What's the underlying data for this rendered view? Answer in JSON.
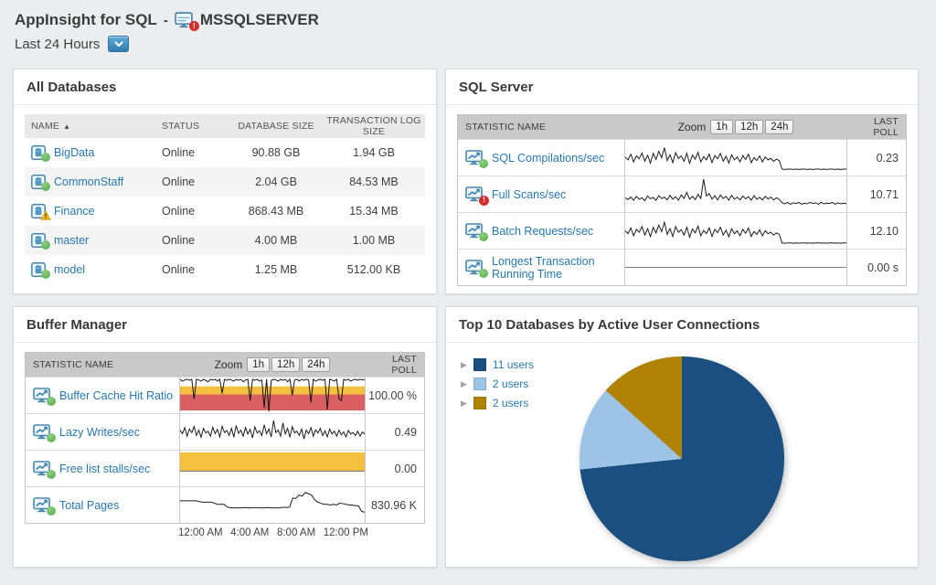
{
  "header": {
    "title": "AppInsight for SQL",
    "dash": "-",
    "server": "MSSQLSERVER",
    "time_range": "Last 24 Hours"
  },
  "panels": {
    "all_databases": {
      "title": "All Databases",
      "col_name": "NAME",
      "col_status": "STATUS",
      "col_db_size": "DATABASE SIZE",
      "col_log_size": "TRANSACTION LOG SIZE",
      "rows": [
        {
          "name": "BigData",
          "status": "Online",
          "db_size": "90.88 GB",
          "log_size": "1.94 GB"
        },
        {
          "name": "CommonStaff",
          "status": "Online",
          "db_size": "2.04 GB",
          "log_size": "84.53 MB"
        },
        {
          "name": "Finance",
          "status": "Online",
          "db_size": "868.43 MB",
          "log_size": "15.34 MB"
        },
        {
          "name": "master",
          "status": "Online",
          "db_size": "4.00 MB",
          "log_size": "1.00 MB"
        },
        {
          "name": "model",
          "status": "Online",
          "db_size": "1.25 MB",
          "log_size": "512.00 KB"
        }
      ]
    },
    "sql_server": {
      "title": "SQL Server",
      "col_stat": "STATISTIC NAME",
      "zoom_label": "Zoom",
      "zoom_options": [
        "1h",
        "12h",
        "24h"
      ],
      "col_last_poll": "LAST POLL",
      "rows": [
        {
          "name": "SQL Compilations/sec",
          "last_poll": "0.23"
        },
        {
          "name": "Full Scans/sec",
          "last_poll": "10.71"
        },
        {
          "name": "Batch Requests/sec",
          "last_poll": "12.10"
        },
        {
          "name": "Longest Transaction Running Time",
          "last_poll": "0.00 s"
        }
      ]
    },
    "buffer_manager": {
      "title": "Buffer Manager",
      "col_stat": "STATISTIC NAME",
      "zoom_label": "Zoom",
      "zoom_options": [
        "1h",
        "12h",
        "24h"
      ],
      "col_last_poll": "LAST POLL",
      "rows": [
        {
          "name": "Buffer Cache Hit Ratio",
          "last_poll": "100.00 %"
        },
        {
          "name": "Lazy Writes/sec",
          "last_poll": "0.49"
        },
        {
          "name": "Free list stalls/sec",
          "last_poll": "0.00"
        },
        {
          "name": "Total Pages",
          "last_poll": "830.96 K"
        }
      ],
      "x_axis": [
        "12:00 AM",
        "4:00 AM",
        "8:00 AM",
        "12:00 PM"
      ]
    },
    "top10": {
      "title": "Top 10 Databases by Active User Connections",
      "legend": [
        {
          "label": "11 users"
        },
        {
          "label": "2 users"
        },
        {
          "label": "2 users"
        }
      ]
    }
  },
  "colors": {
    "link_blue": "#2878b0",
    "critical_red": "#d22f2f",
    "up_green": "#55a94a",
    "warning_yellow": "#f5b819",
    "threshold_yellow": "#f3c13d",
    "threshold_red": "#d95f62",
    "value_red": "#d9454f"
  },
  "chart_data": [
    {
      "id": "sql_compilations_per_sec",
      "type": "line",
      "title": "SQL Compilations/sec",
      "x_range": "last 24 hours",
      "line_color": "#1c1c1c",
      "values": [
        0.52,
        0.44,
        0.6,
        0.38,
        0.55,
        0.47,
        0.63,
        0.4,
        0.57,
        0.35,
        0.62,
        0.45,
        0.68,
        0.5,
        0.78,
        0.42,
        0.58,
        0.36,
        0.64,
        0.48,
        0.55,
        0.4,
        0.62,
        0.34,
        0.57,
        0.46,
        0.65,
        0.38,
        0.53,
        0.44,
        0.6,
        0.36,
        0.56,
        0.47,
        0.62,
        0.4,
        0.54,
        0.35,
        0.58,
        0.44,
        0.52,
        0.38,
        0.56,
        0.45,
        0.6,
        0.36,
        0.5,
        0.42,
        0.55,
        0.38,
        0.52,
        0.44,
        0.48,
        0.4,
        0.46,
        0.42,
        0.18,
        0.17,
        0.18,
        0.18,
        0.17,
        0.18,
        0.17,
        0.18,
        0.18,
        0.17,
        0.18,
        0.17,
        0.18,
        0.18,
        0.17,
        0.18,
        0.17,
        0.18,
        0.18,
        0.17,
        0.18,
        0.17,
        0.18,
        0.18
      ]
    },
    {
      "id": "full_scans_per_sec",
      "type": "line",
      "title": "Full Scans/sec",
      "x_range": "last 24 hours",
      "line_color": "#1c1c1c",
      "values": [
        0.4,
        0.35,
        0.42,
        0.33,
        0.44,
        0.36,
        0.4,
        0.32,
        0.45,
        0.37,
        0.41,
        0.33,
        0.46,
        0.38,
        0.42,
        0.34,
        0.47,
        0.36,
        0.43,
        0.33,
        0.48,
        0.38,
        0.55,
        0.36,
        0.44,
        0.35,
        0.5,
        0.38,
        0.92,
        0.45,
        0.52,
        0.36,
        0.46,
        0.34,
        0.48,
        0.38,
        0.44,
        0.33,
        0.47,
        0.36,
        0.42,
        0.34,
        0.45,
        0.37,
        0.43,
        0.33,
        0.46,
        0.36,
        0.41,
        0.34,
        0.44,
        0.37,
        0.42,
        0.34,
        0.4,
        0.36,
        0.26,
        0.23,
        0.27,
        0.22,
        0.26,
        0.24,
        0.27,
        0.22,
        0.25,
        0.23,
        0.27,
        0.24,
        0.26,
        0.22,
        0.27,
        0.23,
        0.25,
        0.24,
        0.27,
        0.22,
        0.26,
        0.23,
        0.25,
        0.24
      ]
    },
    {
      "id": "batch_requests_per_sec",
      "type": "line",
      "title": "Batch Requests/sec",
      "x_range": "last 24 hours",
      "line_color": "#1c1c1c",
      "values": [
        0.5,
        0.42,
        0.58,
        0.36,
        0.54,
        0.46,
        0.62,
        0.38,
        0.56,
        0.34,
        0.6,
        0.44,
        0.66,
        0.48,
        0.74,
        0.4,
        0.56,
        0.34,
        0.62,
        0.46,
        0.53,
        0.38,
        0.6,
        0.32,
        0.55,
        0.44,
        0.63,
        0.36,
        0.51,
        0.42,
        0.58,
        0.34,
        0.54,
        0.45,
        0.6,
        0.38,
        0.52,
        0.33,
        0.56,
        0.42,
        0.5,
        0.36,
        0.54,
        0.43,
        0.58,
        0.34,
        0.48,
        0.4,
        0.53,
        0.36,
        0.5,
        0.42,
        0.46,
        0.38,
        0.44,
        0.4,
        0.16,
        0.15,
        0.16,
        0.16,
        0.15,
        0.16,
        0.15,
        0.16,
        0.16,
        0.15,
        0.16,
        0.15,
        0.16,
        0.16,
        0.15,
        0.16,
        0.15,
        0.16,
        0.16,
        0.15,
        0.16,
        0.15,
        0.16,
        0.16
      ]
    },
    {
      "id": "longest_transaction_running_time",
      "type": "line",
      "title": "Longest Transaction Running Time",
      "x_range": "last 24 hours",
      "line_color": "#808080",
      "values": [
        0.5,
        0.5
      ]
    },
    {
      "id": "buffer_cache_hit_ratio",
      "type": "line",
      "title": "Buffer Cache Hit Ratio",
      "x_range": "last 24 hours",
      "line_color": "#161616",
      "bands": [
        {
          "y0": 0.075,
          "y1": 0.525,
          "color": "#d95f62"
        },
        {
          "y0": 0.525,
          "y1": 0.75,
          "color": "#f3c13d"
        }
      ],
      "values": [
        0.95,
        0.9,
        0.93,
        0.95,
        0.92,
        0.95,
        0.4,
        0.95,
        0.93,
        0.9,
        0.95,
        0.92,
        0.88,
        0.95,
        0.93,
        0.95,
        0.9,
        0.95,
        0.55,
        0.95,
        0.92,
        0.95,
        0.93,
        0.9,
        0.95,
        0.92,
        0.95,
        0.88,
        0.93,
        0.95,
        0.35,
        0.95,
        0.92,
        0.95,
        0.9,
        0.93,
        0.15,
        0.95,
        0.05,
        0.92,
        0.95,
        0.93,
        0.9,
        0.95,
        0.92,
        0.95,
        0.88,
        0.95,
        0.5,
        0.93,
        0.95,
        0.9,
        0.95,
        0.92,
        0.95,
        0.93,
        0.3,
        0.95,
        0.9,
        0.93,
        0.95,
        0.92,
        0.95,
        0.1,
        0.95,
        0.93,
        0.9,
        0.95,
        0.4,
        0.35,
        0.95,
        0.92,
        0.95,
        0.9,
        0.93,
        0.95,
        0.92,
        0.95,
        0.93,
        0.95
      ]
    },
    {
      "id": "lazy_writes_per_sec",
      "type": "line",
      "title": "Lazy Writes/sec",
      "x_range": "last 24 hours",
      "line_color": "#1c1c1c",
      "values": [
        0.55,
        0.45,
        0.62,
        0.38,
        0.58,
        0.48,
        0.65,
        0.4,
        0.55,
        0.35,
        0.6,
        0.47,
        0.52,
        0.38,
        0.63,
        0.45,
        0.57,
        0.36,
        0.66,
        0.48,
        0.54,
        0.4,
        0.6,
        0.35,
        0.68,
        0.46,
        0.55,
        0.38,
        0.62,
        0.44,
        0.57,
        0.33,
        0.64,
        0.47,
        0.53,
        0.4,
        0.7,
        0.45,
        0.58,
        0.36,
        0.82,
        0.48,
        0.55,
        0.38,
        0.75,
        0.44,
        0.6,
        0.35,
        0.65,
        0.47,
        0.52,
        0.4,
        0.58,
        0.3,
        0.55,
        0.45,
        0.62,
        0.38,
        0.56,
        0.47,
        0.6,
        0.4,
        0.53,
        0.36,
        0.58,
        0.44,
        0.52,
        0.38,
        0.55,
        0.42,
        0.5,
        0.36,
        0.54,
        0.44,
        0.48,
        0.4,
        0.52,
        0.38,
        0.5,
        0.44
      ]
    },
    {
      "id": "free_list_stalls_per_sec",
      "type": "line",
      "title": "Free list stalls/sec",
      "x_range": "last 24 hours",
      "line_color": "#6e6e6e",
      "bands": [
        {
          "y0": 0.425,
          "y1": 0.95,
          "color": "#f3c13d"
        }
      ],
      "values": [
        0.425,
        0.425
      ]
    },
    {
      "id": "total_pages",
      "type": "line",
      "title": "Total Pages",
      "x_range": "last 24 hours",
      "line_color": "#1c1c1c",
      "values": [
        0.62,
        0.62,
        0.62,
        0.62,
        0.62,
        0.62,
        0.6,
        0.58,
        0.58,
        0.58,
        0.58,
        0.55,
        0.52,
        0.52,
        0.52,
        0.45,
        0.42,
        0.42,
        0.42,
        0.42,
        0.42,
        0.43,
        0.42,
        0.42,
        0.43,
        0.42,
        0.42,
        0.42,
        0.43,
        0.42,
        0.42,
        0.42,
        0.42,
        0.44,
        0.43,
        0.44,
        0.7,
        0.68,
        0.78,
        0.75,
        0.85,
        0.82,
        0.78,
        0.65,
        0.58,
        0.55,
        0.52,
        0.52,
        0.5,
        0.52,
        0.5,
        0.55,
        0.54,
        0.52,
        0.5,
        0.5,
        0.48,
        0.48,
        0.32,
        0.3
      ]
    },
    {
      "id": "top10_active_user_connections",
      "type": "pie",
      "title": "Top 10 Databases by Active User Connections",
      "labels": [
        "11 users",
        "2 users",
        "2 users"
      ],
      "values": [
        11,
        2,
        2
      ],
      "colors": [
        "#1b4f80",
        "#9dc4e4",
        "#b08306"
      ]
    }
  ]
}
